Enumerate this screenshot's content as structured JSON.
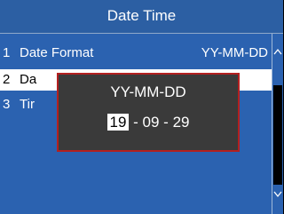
{
  "header": {
    "title": "Date Time"
  },
  "menu": {
    "items": [
      {
        "index": "1",
        "label": "Date Format",
        "value": "YY-MM-DD"
      },
      {
        "index": "2",
        "label": "Da",
        "value": ""
      },
      {
        "index": "3",
        "label": "Tir",
        "value": ""
      }
    ],
    "selected_index": 2
  },
  "dialog": {
    "title": "YY-MM-DD",
    "year": "19",
    "sep1": " - ",
    "month": "09",
    "sep2": " - ",
    "day": "29"
  },
  "scrollbar": {
    "up_icon": "chevron-up-icon",
    "down_icon": "chevron-down-icon"
  },
  "colors": {
    "title_bar": "#2c5fa3",
    "list_bg": "#2b62b0",
    "dialog_bg": "#3a3a3a",
    "dialog_border": "#b32020",
    "selected_row": "#ffffff"
  }
}
